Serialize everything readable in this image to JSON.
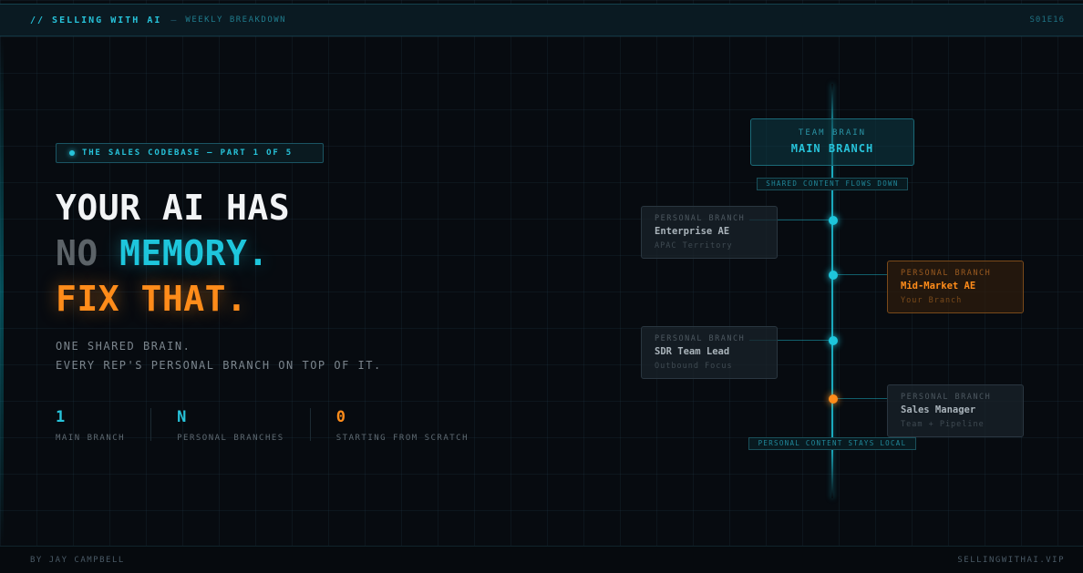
{
  "header": {
    "brand": "// SELLING WITH AI",
    "separator": "—",
    "subtitle": "WEEKLY BREAKDOWN",
    "episode": "S01E16"
  },
  "tag": {
    "text": "THE SALES CODEBASE — PART 1 OF 5"
  },
  "headline": {
    "line1": "YOUR AI HAS",
    "line2_a": "NO",
    "line2_b": "MEMORY",
    "line2_dot": ".",
    "line3": "FIX THAT",
    "line3_dot": "."
  },
  "subtext": {
    "line1": "ONE SHARED BRAIN.",
    "line2": "EVERY REP'S PERSONAL BRANCH ON TOP OF IT."
  },
  "stats": [
    {
      "value": "1",
      "label": "MAIN BRANCH"
    },
    {
      "value": "N",
      "label": "PERSONAL BRANCHES"
    },
    {
      "value": "0",
      "label": "STARTING FROM SCRATCH"
    }
  ],
  "diagram": {
    "main": {
      "kicker": "TEAM BRAIN",
      "name": "MAIN BRANCH"
    },
    "flow_top": "SHARED CONTENT FLOWS DOWN",
    "flow_bottom": "PERSONAL CONTENT STAYS LOCAL",
    "branches": [
      {
        "kicker": "PERSONAL BRANCH",
        "name": "Enterprise AE",
        "detail": "APAC Territory"
      },
      {
        "kicker": "PERSONAL BRANCH",
        "name": "Mid-Market AE",
        "detail": "Your Branch"
      },
      {
        "kicker": "PERSONAL BRANCH",
        "name": "SDR Team Lead",
        "detail": "Outbound Focus"
      },
      {
        "kicker": "PERSONAL BRANCH",
        "name": "Sales Manager",
        "detail": "Team + Pipeline"
      }
    ]
  },
  "footer": {
    "author": "BY JAY CAMPBELL",
    "site": "SELLINGWITHAI.VIP"
  },
  "colors": {
    "accent_cyan": "#1ec6dc",
    "accent_orange": "#ff8c1a",
    "background": "#070b10"
  }
}
